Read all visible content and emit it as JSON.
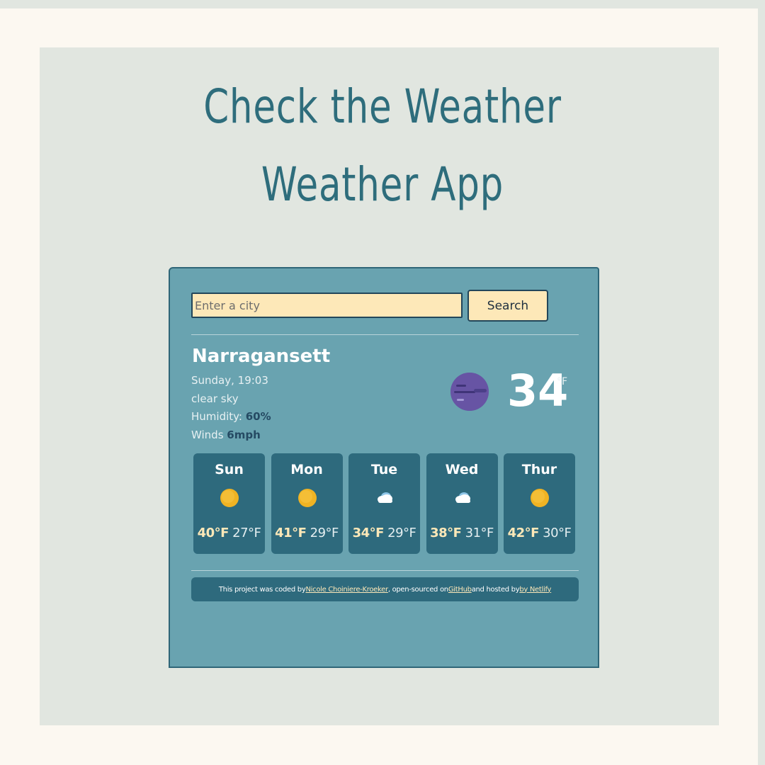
{
  "title": {
    "line1": "Check the Weather",
    "line2": "Weather App"
  },
  "search": {
    "placeholder": "Enter a city",
    "button_label": "Search"
  },
  "current": {
    "city": "Narragansett",
    "datetime": "Sunday, 19:03",
    "description": "clear sky",
    "humidity_label": "Humidity: ",
    "humidity_value": "60%",
    "wind_label": "Winds ",
    "wind_value": "6mph",
    "icon": "night-moon-icon",
    "temperature": "34",
    "unit": "°F"
  },
  "forecast": [
    {
      "day": "Sun",
      "icon": "sun-icon",
      "max": "40°F",
      "min": "27°F"
    },
    {
      "day": "Mon",
      "icon": "sun-icon",
      "max": "41°F",
      "min": "29°F"
    },
    {
      "day": "Tue",
      "icon": "cloud-icon",
      "max": "34°F",
      "min": "29°F"
    },
    {
      "day": "Wed",
      "icon": "cloud-icon",
      "max": "38°F",
      "min": "31°F"
    },
    {
      "day": "Thur",
      "icon": "sun-icon",
      "max": "42°F",
      "min": "30°F"
    }
  ],
  "footer": {
    "text1": "This project was coded by ",
    "author": "Nicole Choiniere-Kroeker",
    "text2": " , open-sourced on ",
    "github": "GitHub ",
    "text3": "and hosted by ",
    "netlify": "by Netlify"
  },
  "colors": {
    "accent": "#2e6d7c",
    "card": "#69a3b0",
    "highlight": "#fde8b8"
  }
}
